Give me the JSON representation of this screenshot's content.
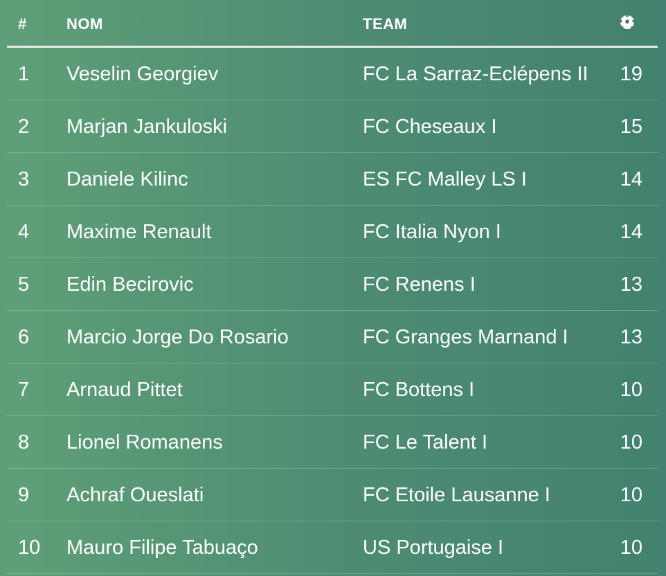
{
  "header": {
    "rank_label": "#",
    "name_label": "NOM",
    "team_label": "TEAM",
    "goals_icon": "soccer-ball-icon"
  },
  "rows": [
    {
      "rank": "1",
      "name": "Veselin Georgiev",
      "team": "FC La Sarraz-Eclépens II",
      "goals": "19"
    },
    {
      "rank": "2",
      "name": "Marjan Jankuloski",
      "team": "FC Cheseaux I",
      "goals": "15"
    },
    {
      "rank": "3",
      "name": "Daniele Kilinc",
      "team": "ES FC Malley LS I",
      "goals": "14"
    },
    {
      "rank": "4",
      "name": "Maxime Renault",
      "team": "FC Italia Nyon I",
      "goals": "14"
    },
    {
      "rank": "5",
      "name": "Edin Becirovic",
      "team": "FC Renens I",
      "goals": "13"
    },
    {
      "rank": "6",
      "name": "Marcio Jorge Do Rosario",
      "team": "FC Granges Marnand I",
      "goals": "13"
    },
    {
      "rank": "7",
      "name": "Arnaud Pittet",
      "team": "FC Bottens I",
      "goals": "10"
    },
    {
      "rank": "8",
      "name": "Lionel Romanens",
      "team": "FC Le Talent I",
      "goals": "10"
    },
    {
      "rank": "9",
      "name": "Achraf Oueslati",
      "team": "FC Etoile Lausanne I",
      "goals": "10"
    },
    {
      "rank": "10",
      "name": "Mauro Filipe Tabuaço",
      "team": "US Portugaise I",
      "goals": "10"
    }
  ],
  "colors": {
    "background_start": "#5f9f78",
    "background_end": "#438170",
    "text": "#ffffff"
  }
}
